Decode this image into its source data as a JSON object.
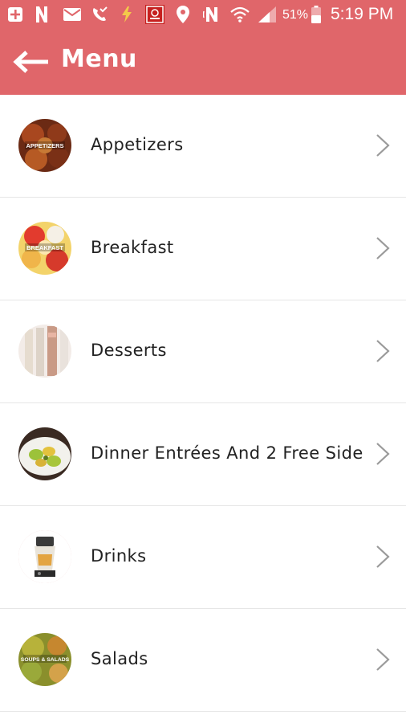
{
  "status_bar": {
    "icons": [
      "add-box-icon",
      "netflix-icon",
      "mail-icon",
      "missed-call-icon",
      "flash-icon",
      "app-notification-icon",
      "location-icon",
      "nfc-icon",
      "wifi-icon",
      "signal-icon",
      "battery-icon"
    ],
    "battery_percent": "51%",
    "time": "5:19 PM"
  },
  "toolbar": {
    "title": "Menu",
    "back_icon": "arrow-left-icon"
  },
  "menu": {
    "items": [
      {
        "label": "Appetizers",
        "thumb_text": "APPETIZERS"
      },
      {
        "label": "Breakfast",
        "thumb_text": "BREAKFAST"
      },
      {
        "label": "Desserts",
        "thumb_text": ""
      },
      {
        "label": "Dinner Entrées And 2 Free Side",
        "thumb_text": ""
      },
      {
        "label": "Drinks",
        "thumb_text": ""
      },
      {
        "label": "Salads",
        "thumb_text": "SOUPS & SALADS"
      }
    ],
    "chevron_icon": "chevron-right-icon"
  },
  "colors": {
    "header": "#e0666a",
    "text": "#222222",
    "divider": "#e6e6e6",
    "chevron": "#9a9a9a"
  }
}
